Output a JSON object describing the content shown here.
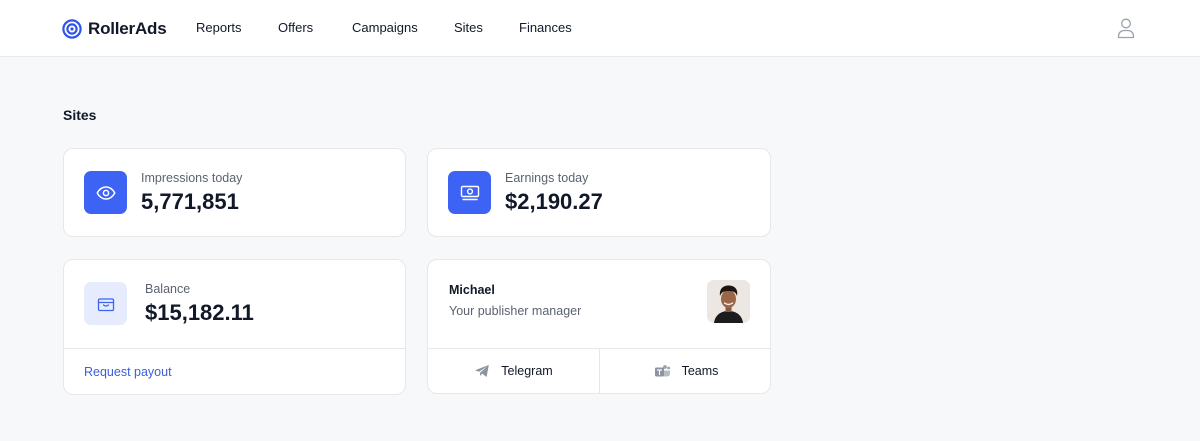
{
  "header": {
    "brand": "RollerAds",
    "nav": [
      "Reports",
      "Offers",
      "Campaigns",
      "Sites",
      "Finances"
    ],
    "user_icon": "user-icon"
  },
  "page": {
    "title": "Sites"
  },
  "cards": {
    "impressions": {
      "label": "Impressions today",
      "value": "5,771,851",
      "icon": "eye-icon"
    },
    "earnings": {
      "label": "Earnings today",
      "value": "$2,190.27",
      "icon": "money-icon"
    },
    "balance": {
      "label": "Balance",
      "value": "$15,182.11",
      "icon": "wallet-icon",
      "action": "Request payout"
    },
    "manager": {
      "name": "Michael",
      "role": "Your publisher manager",
      "telegram": "Telegram",
      "teams": "Teams"
    }
  },
  "colors": {
    "accent": "#3d63f5",
    "accent_light": "#e6ebfd",
    "link": "#3b5fd9"
  }
}
